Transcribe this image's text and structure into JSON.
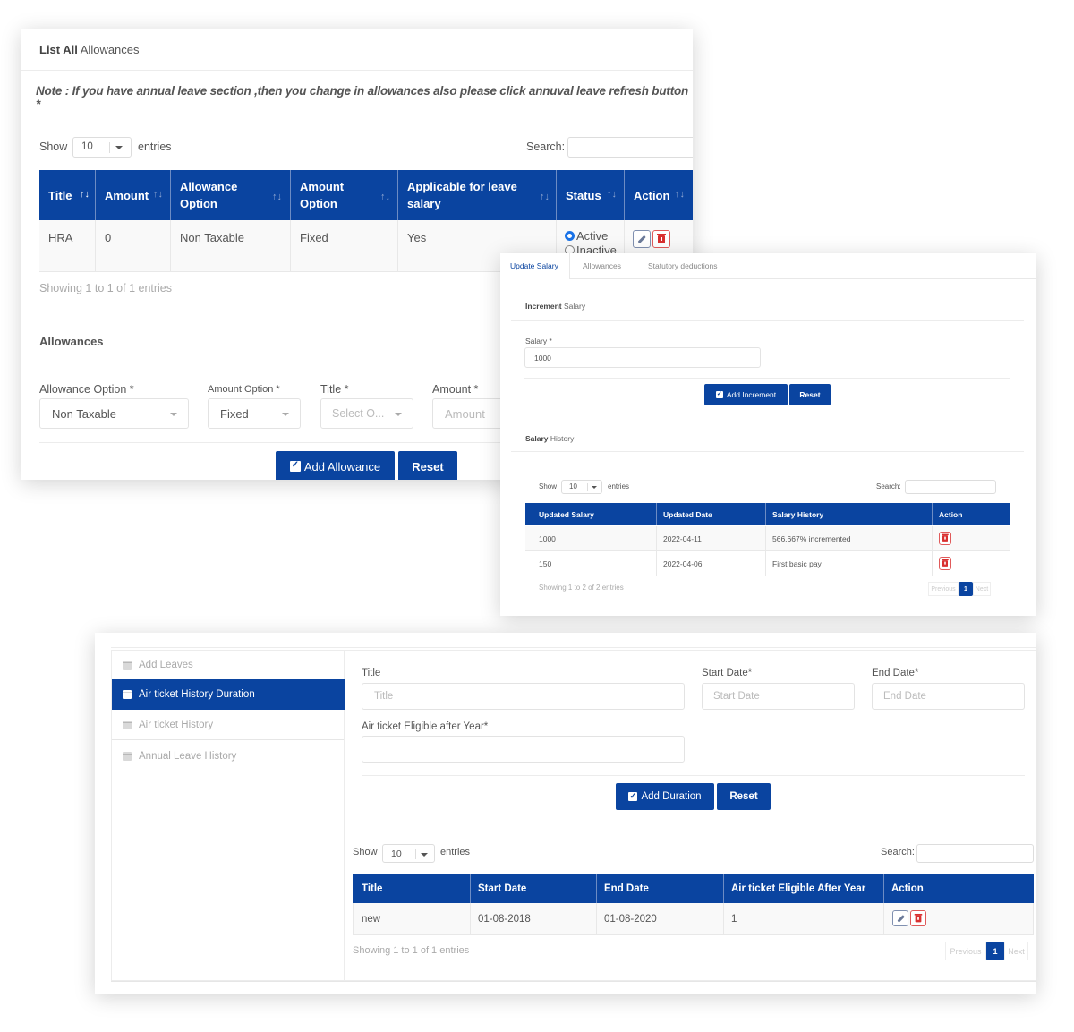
{
  "allowances_card": {
    "header_bold": "List All",
    "header_rest": "Allowances",
    "note": "Note : If you have annual leave section ,then you change in allowances also please click annuval leave refresh button *",
    "length_label_pre": "Show",
    "length_value": "10",
    "length_label_post": "entries",
    "search_label": "Search:",
    "search_value": "",
    "columns": [
      "Title",
      "Amount",
      "Allowance Option",
      "Amount Option",
      "Applicable for leave salary",
      "Status",
      "Action"
    ],
    "rows": [
      {
        "title": "HRA",
        "amount": "0",
        "allowance_option": "Non Taxable",
        "amount_option": "Fixed",
        "leave_salary": "Yes",
        "status_active": "Active",
        "status_inactive": "Inactive",
        "status_selected": "Active"
      }
    ],
    "info": "Showing 1 to 1 of 1 entries",
    "form_title": "Allowances",
    "form": {
      "allowance_option_label": "Allowance Option *",
      "allowance_option_value": "Non Taxable",
      "amount_option_label": "Amount Option *",
      "amount_option_value": "Fixed",
      "title_label": "Title *",
      "title_placeholder": "Select O...",
      "amount_label": "Amount *",
      "amount_placeholder": "Amount"
    },
    "add_button": "Add Allowance",
    "reset_button": "Reset"
  },
  "salary_card": {
    "tabs": [
      {
        "label": "Update Salary",
        "active": true
      },
      {
        "label": "Allowances",
        "active": false
      },
      {
        "label": "Statutory deductions",
        "active": false
      }
    ],
    "increment_bold": "Increment",
    "increment_rest": "Salary",
    "salary_label": "Salary *",
    "salary_value": "1000",
    "add_button": "Add Increment",
    "reset_button": "Reset",
    "history_bold": "Salary",
    "history_rest": "History",
    "length_label_pre": "Show",
    "length_value": "10",
    "length_label_post": "entries",
    "search_label": "Search:",
    "columns": [
      "Updated Salary",
      "Updated Date",
      "Salary History",
      "Action"
    ],
    "rows": [
      {
        "salary": "1000",
        "date": "2022-04-11",
        "history": "566.667% incremented"
      },
      {
        "salary": "150",
        "date": "2022-04-06",
        "history": "First basic pay"
      }
    ],
    "info": "Showing 1 to 2 of 2 entries",
    "pager": {
      "prev": "Previous",
      "current": "1",
      "next": "Next"
    }
  },
  "airticket_card": {
    "menu": [
      {
        "label": "Add Leaves",
        "active": false
      },
      {
        "label": "Air ticket History Duration",
        "active": true
      },
      {
        "label": "Air ticket History",
        "active": false
      },
      {
        "label": "Annual Leave History",
        "active": false
      }
    ],
    "form": {
      "title_label": "Title",
      "title_placeholder": "Title",
      "start_label": "Start Date*",
      "start_placeholder": "Start Date",
      "end_label": "End Date*",
      "end_placeholder": "End Date",
      "eligible_label": "Air ticket Eligible after Year*",
      "eligible_value": ""
    },
    "add_button": "Add Duration",
    "reset_button": "Reset",
    "length_label_pre": "Show",
    "length_value": "10",
    "length_label_post": "entries",
    "search_label": "Search:",
    "columns": [
      "Title",
      "Start Date",
      "End Date",
      "Air ticket Eligible After Year",
      "Action"
    ],
    "rows": [
      {
        "title": "new",
        "start": "01-08-2018",
        "end": "01-08-2020",
        "eligible": "1"
      }
    ],
    "info": "Showing 1 to 1 of 1 entries",
    "pager": {
      "prev": "Previous",
      "current": "1",
      "next": "Next"
    }
  }
}
